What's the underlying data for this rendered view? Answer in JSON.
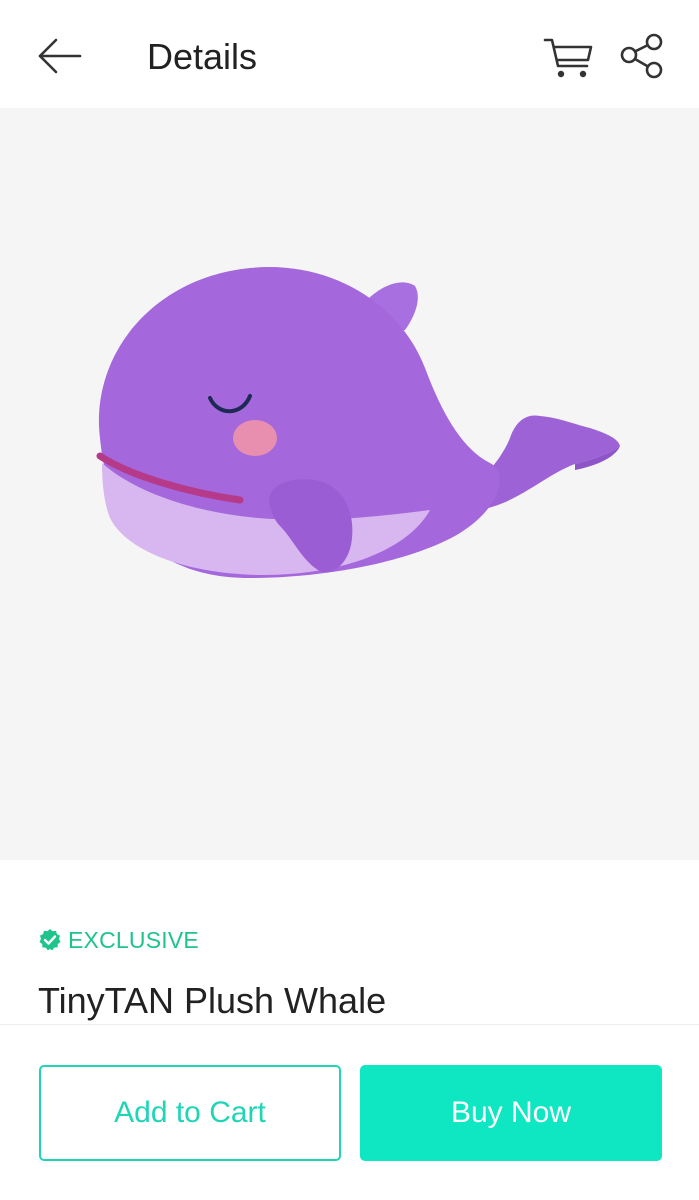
{
  "header": {
    "title": "Details",
    "back_icon": "arrow-left-icon",
    "cart_icon": "cart-icon",
    "share_icon": "share-icon"
  },
  "product": {
    "image_alt": "Purple whale plush toy",
    "badge": "EXCLUSIVE",
    "badge_icon": "verified-check-icon",
    "name": "TinyTAN Plush Whale"
  },
  "actions": {
    "add_to_cart": "Add to Cart",
    "buy_now": "Buy Now"
  },
  "colors": {
    "accent": "#0fe6c2",
    "accent_outline": "#1fd5b6",
    "badge_green": "#1ec48a",
    "image_bg": "#f5f5f5"
  }
}
